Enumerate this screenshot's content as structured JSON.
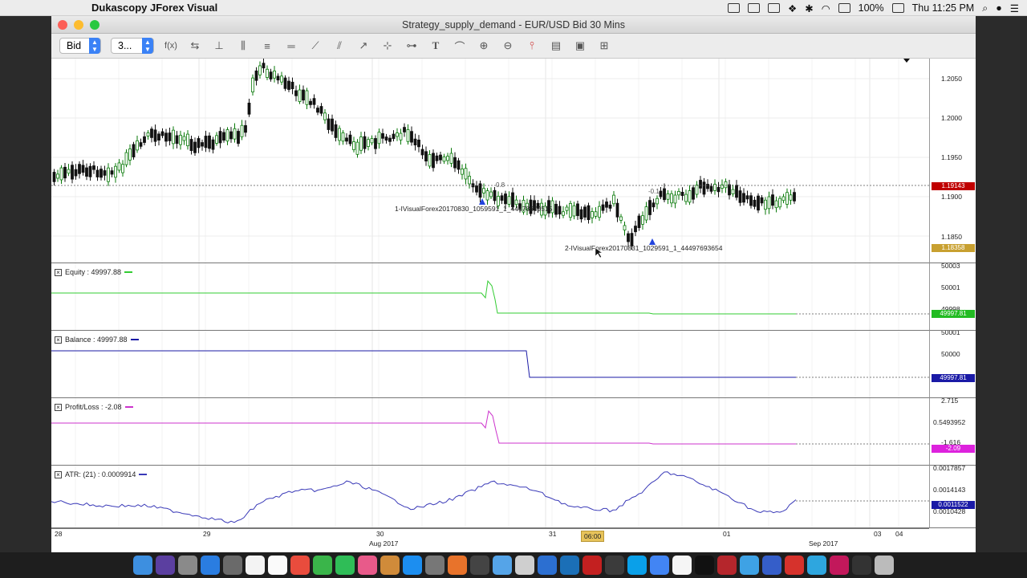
{
  "menubar": {
    "app_name": "Dukascopy JForex Visual",
    "battery": "100%",
    "clock": "Thu 11:25 PM"
  },
  "window": {
    "title": "Strategy_supply_demand - EUR/USD Bid 30 Mins"
  },
  "toolbar": {
    "side_select": "Bid",
    "period_select": "3...",
    "f_label": "f(x)",
    "text_tool": "T"
  },
  "price_chart": {
    "y_ticks": [
      "1.2050",
      "1.2000",
      "1.1950",
      "1.1900",
      "1.1850"
    ],
    "current_price_tag": "1.19143",
    "low_tag": "1.18358",
    "order_label_1": "1-IVisualForex20170830_1059591_1_44478609515",
    "order_label_2": "2-IVisualForex20170831_1029591_1_44497693654",
    "marker_1": "0.8",
    "marker_2": "-0.1",
    "colors": {
      "bull": "#0a7a0a",
      "bear": "#111111",
      "price_tag": "#c00000",
      "low_tag": "#c8a030"
    }
  },
  "equity_pane": {
    "legend": "Equity : 49997.88",
    "y_ticks": [
      "50003",
      "50001",
      "49998"
    ],
    "value_tag": "49997.81",
    "color": "#33cc33"
  },
  "balance_pane": {
    "legend": "Balance : 49997.88",
    "y_ticks": [
      "50001",
      "50000"
    ],
    "value_tag": "49997.81",
    "color": "#1a1aa6"
  },
  "pl_pane": {
    "legend": "Profit/Loss : -2.08",
    "y_ticks": [
      "2.715",
      "0.5493952",
      "-1.616"
    ],
    "value_tag": "-2.09",
    "color": "#cc33cc"
  },
  "atr_pane": {
    "legend": "ATR: (21) : 0.0009914",
    "y_ticks": [
      "0.0017857",
      "0.0014143",
      "0.0010428"
    ],
    "value_tag": "0.0011522",
    "color": "#3a3ab8"
  },
  "x_axis": {
    "day_labels": [
      "28",
      "29",
      "30",
      "31",
      "01",
      "03",
      "04"
    ],
    "month_labels": [
      "Aug 2017",
      "Sep 2017"
    ],
    "cursor_time": "06:00"
  }
}
